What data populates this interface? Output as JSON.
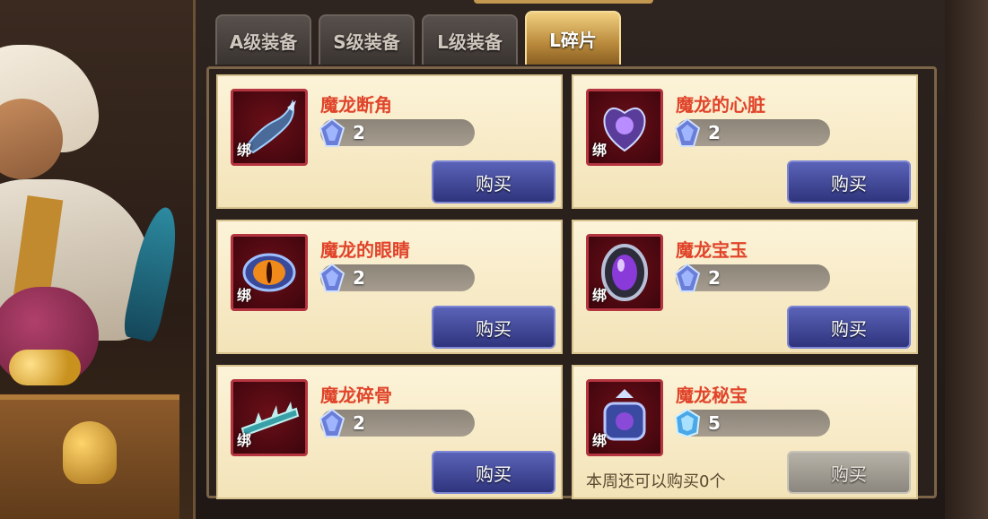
{
  "tabs": [
    {
      "label": "A级装备",
      "active": false
    },
    {
      "label": "S级装备",
      "active": false
    },
    {
      "label": "L级装备",
      "active": false
    },
    {
      "label": "L碎片",
      "active": true
    }
  ],
  "items": [
    {
      "name": "魔龙断角",
      "bind_tag": "绑",
      "quantity": "2",
      "buy_label": "购买",
      "icon": "dragon-horn-icon"
    },
    {
      "name": "魔龙的心脏",
      "bind_tag": "绑",
      "quantity": "2",
      "buy_label": "购买",
      "icon": "dragon-heart-icon"
    },
    {
      "name": "魔龙的眼睛",
      "bind_tag": "绑",
      "quantity": "2",
      "buy_label": "购买",
      "icon": "dragon-eye-icon"
    },
    {
      "name": "魔龙宝玉",
      "bind_tag": "绑",
      "quantity": "2",
      "buy_label": "购买",
      "icon": "dragon-jewel-icon"
    },
    {
      "name": "魔龙碎骨",
      "bind_tag": "绑",
      "quantity": "2",
      "buy_label": "购买",
      "icon": "dragon-bone-icon"
    },
    {
      "name": "魔龙秘宝",
      "bind_tag": "绑",
      "quantity": "5",
      "buy_label": "购买",
      "icon": "dragon-treasure-icon",
      "limit_text": "本周还可以购买0个",
      "disabled": true
    }
  ],
  "colors": {
    "item_name": "#e0442a",
    "buy_button": "#3a41a0",
    "tab_active": "#d8a84f"
  }
}
